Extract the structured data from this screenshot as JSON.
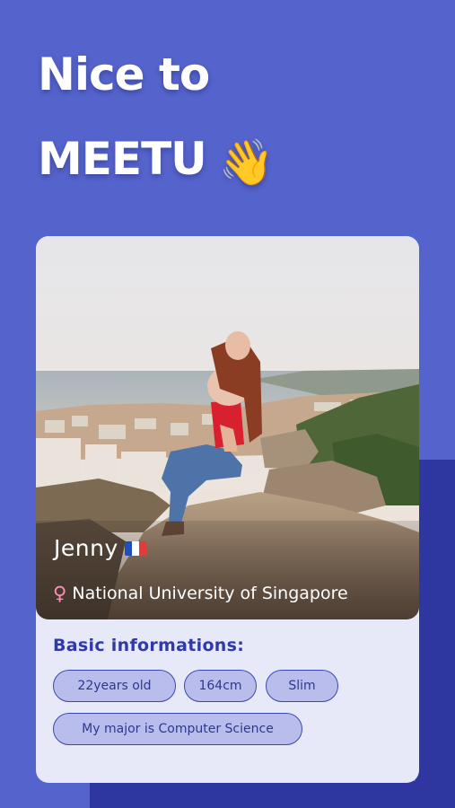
{
  "headline": {
    "line1": "Nice to",
    "line2": "MEETU",
    "emoji": "👋"
  },
  "profile": {
    "name": "Jenny",
    "flag_icon": "france-flag-icon",
    "gender_icon": "♀",
    "school": "National University of Singapore"
  },
  "basic_info": {
    "title": "Basic informations:",
    "tags": [
      "22years old",
      "164cm",
      "Slim",
      "My major is Computer Science"
    ]
  },
  "colors": {
    "background": "#5563cc",
    "card": "#e7e8f8",
    "accent": "#2f3aa8",
    "tag_fill": "#b8bdec",
    "gender_icon": "#ff8fb8"
  }
}
